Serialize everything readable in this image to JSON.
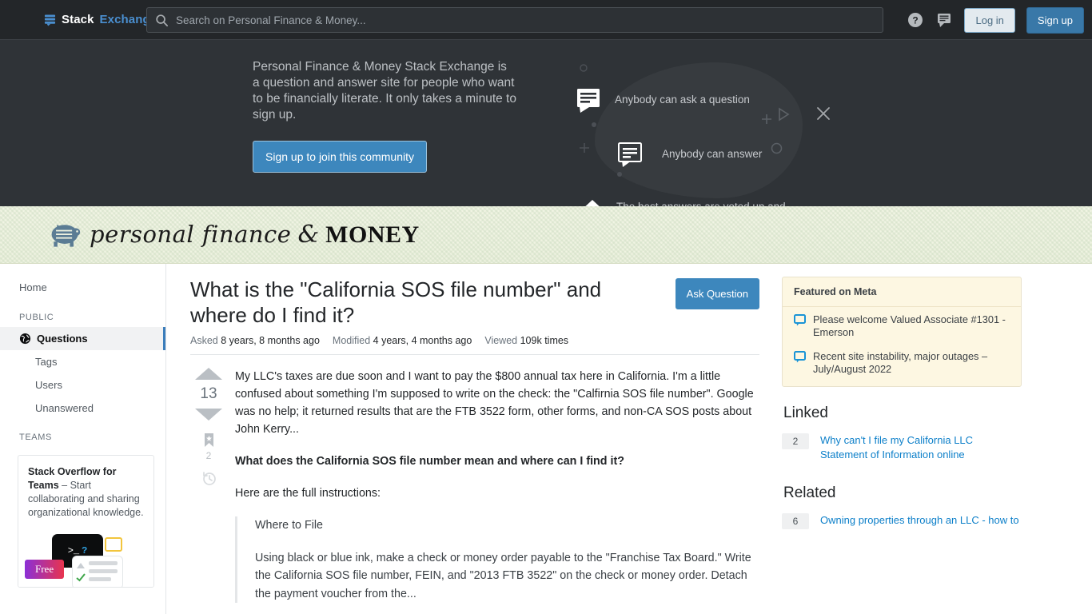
{
  "topbar": {
    "logo_stack": "Stack",
    "logo_exchange": "Exchange",
    "search_placeholder": "Search on Personal Finance & Money...",
    "search_value": "",
    "help_icon": "help-circle-icon",
    "inbox_icon": "inbox-icon",
    "login_label": "Log in",
    "signup_label": "Sign up"
  },
  "hero": {
    "description": "Personal Finance & Money Stack Exchange is a question and answer site for people who want to be financially literate. It only takes a minute to sign up.",
    "cta_label": "Sign up to join this community",
    "points": [
      {
        "icon": "speech-bubble-icon",
        "text": "Anybody can ask a question"
      },
      {
        "icon": "speech-bubble-outline-icon",
        "text": "Anybody can answer"
      },
      {
        "icon": "vote-arrows-icon",
        "text": "The best answers are voted up and rise to the top"
      }
    ],
    "close_icon": "close-icon",
    "play_icon": "play-triangle-icon"
  },
  "site": {
    "logo_icon": "piggy-bank-icon",
    "name_script": "personal finance",
    "name_amp": "&",
    "name_money": "MONEY"
  },
  "sidebar": {
    "home_label": "Home",
    "public_header": "PUBLIC",
    "items": [
      {
        "label": "Questions",
        "icon": "globe-icon",
        "active": true
      },
      {
        "label": "Tags",
        "active": false
      },
      {
        "label": "Users",
        "active": false
      },
      {
        "label": "Unanswered",
        "active": false
      }
    ],
    "teams_header": "TEAMS",
    "teams_promo_bold": "Stack Overflow for Teams",
    "teams_promo_rest": " – Start collaborating and sharing organizational knowledge.",
    "teams_free_badge": "Free",
    "teams_terminal_prompt": ">_",
    "teams_terminal_q": "?"
  },
  "question": {
    "title": "What is the \"California SOS file number\" and where do I find it?",
    "ask_button": "Ask Question",
    "stats": [
      {
        "label": "Asked",
        "value": "8 years, 8 months ago"
      },
      {
        "label": "Modified",
        "value": "4 years, 4 months ago"
      },
      {
        "label": "Viewed",
        "value": "109k times"
      }
    ],
    "vote_score": "13",
    "bookmark_count": "2",
    "upvote_icon": "arrow-up-icon",
    "downvote_icon": "arrow-down-icon",
    "bookmark_icon": "bookmark-icon",
    "history_icon": "history-clock-icon",
    "body_p1": "My LLC's taxes are due soon and I want to pay the $800 annual tax here in California. I'm a little confused about something I'm supposed to write on the check: the \"Calfirnia SOS file number\". Google was no help; it returned results that are the FTB 3522 form, other forms, and non-CA SOS posts about John Kerry...",
    "body_p2": "What does the California SOS file number mean and where can I find it?",
    "body_p3": "Here are the full instructions:",
    "quote_title": "Where to File",
    "quote_body": "Using black or blue ink, make a check or money order payable to the \"Franchise Tax Board.\" Write the California SOS file number, FEIN, and \"2013 FTB 3522\" on the check or money order. Detach the payment voucher from the..."
  },
  "rail": {
    "featured_title": "Featured on Meta",
    "featured_items": [
      "Please welcome Valued Associate #1301 - Emerson",
      "Recent site instability, major outages – July/August 2022"
    ],
    "linked_title": "Linked",
    "linked": [
      {
        "score": "2",
        "title": "Why can't I file my California LLC Statement of Information online"
      }
    ],
    "related_title": "Related",
    "related": [
      {
        "score": "6",
        "title": "Owning properties through an LLC - how to"
      }
    ]
  }
}
